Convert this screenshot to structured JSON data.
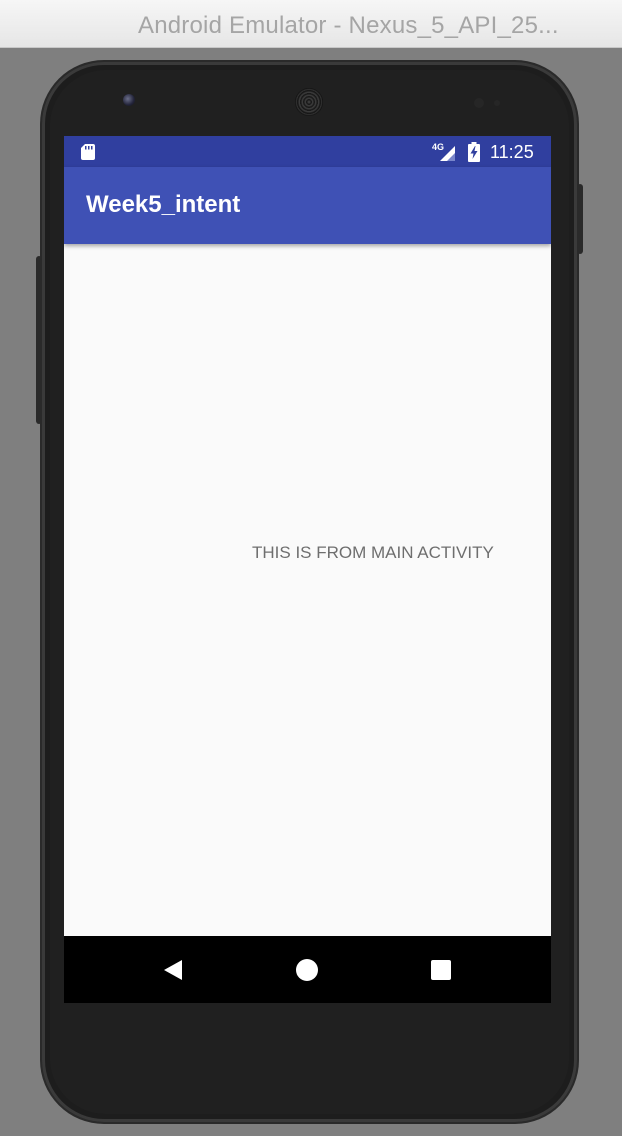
{
  "window": {
    "title": "Android Emulator - Nexus_5_API_25..."
  },
  "statusbar": {
    "time": "11:25",
    "network_label": "4G",
    "icons": [
      "sd-card-icon",
      "signal-icon",
      "battery-charging-icon"
    ]
  },
  "appbar": {
    "title": "Week5_intent"
  },
  "content": {
    "message": "THIS IS FROM MAIN ACTIVITY"
  },
  "navbar": {
    "buttons": [
      "back-icon",
      "home-icon",
      "recents-icon"
    ]
  },
  "colors": {
    "status_bar": "#303f9f",
    "app_bar": "#3f51b5",
    "screen_bg": "#fafafa",
    "nav_bar": "#000000",
    "text_secondary": "#6e6e6e"
  }
}
